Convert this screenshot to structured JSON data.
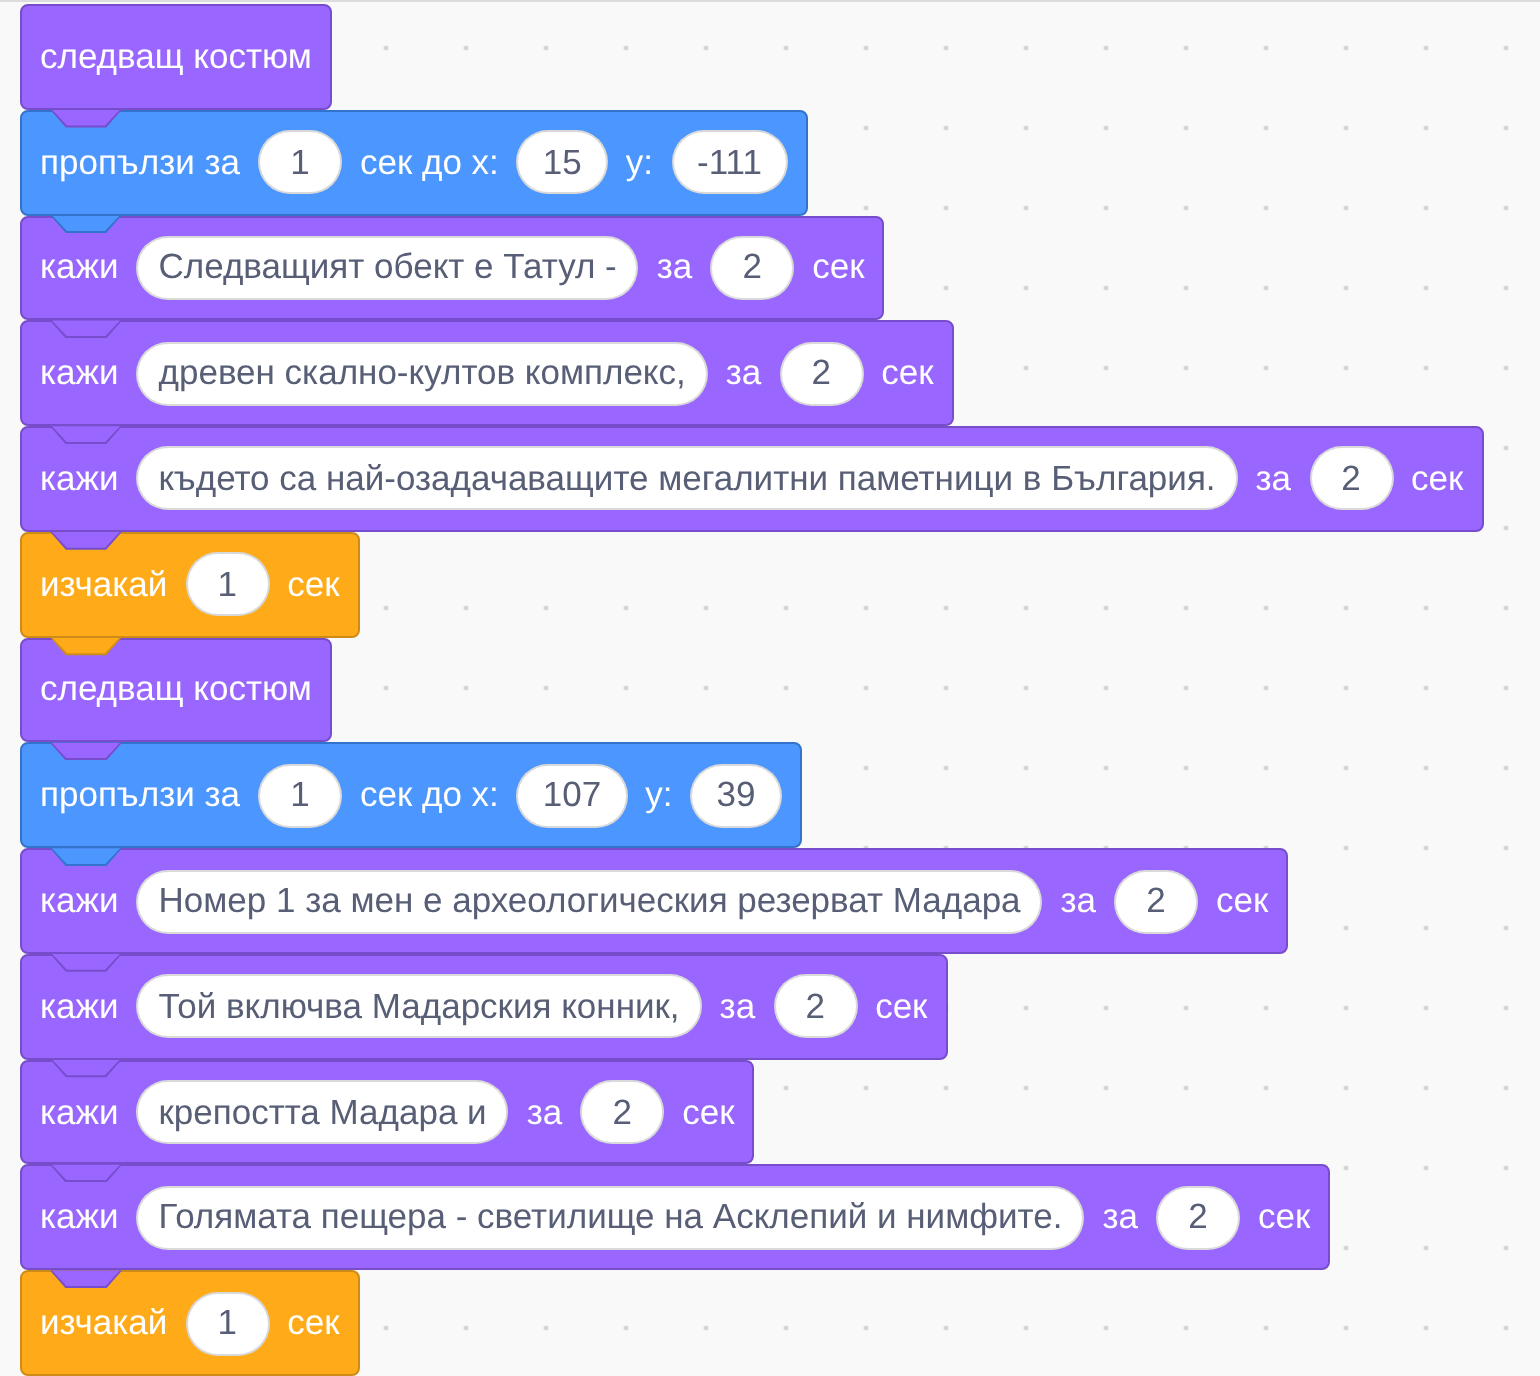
{
  "workspace": {
    "blocks": [
      {
        "kind": "looks",
        "parts": [
          {
            "kind": "label",
            "text": "следващ костюм"
          }
        ]
      },
      {
        "kind": "motion",
        "parts": [
          {
            "kind": "label",
            "text": "пропълзи за"
          },
          {
            "kind": "number",
            "text": "1"
          },
          {
            "kind": "label",
            "text": "сек до x:"
          },
          {
            "kind": "number",
            "text": "15"
          },
          {
            "kind": "label",
            "text": "y:"
          },
          {
            "kind": "number",
            "text": "-111"
          }
        ]
      },
      {
        "kind": "looks",
        "parts": [
          {
            "kind": "label",
            "text": "кажи"
          },
          {
            "kind": "text",
            "text": "Следващият обект е Татул -"
          },
          {
            "kind": "label",
            "text": "за"
          },
          {
            "kind": "number",
            "text": "2"
          },
          {
            "kind": "label",
            "text": "сек"
          }
        ]
      },
      {
        "kind": "looks",
        "parts": [
          {
            "kind": "label",
            "text": "кажи"
          },
          {
            "kind": "text",
            "text": "древен скално-култов комплекс,"
          },
          {
            "kind": "label",
            "text": "за"
          },
          {
            "kind": "number",
            "text": "2"
          },
          {
            "kind": "label",
            "text": "сек"
          }
        ]
      },
      {
        "kind": "looks",
        "parts": [
          {
            "kind": "label",
            "text": "кажи"
          },
          {
            "kind": "text",
            "text": "където са най-озадачаващите мегалитни паметници в България."
          },
          {
            "kind": "label",
            "text": "за"
          },
          {
            "kind": "number",
            "text": "2"
          },
          {
            "kind": "label",
            "text": "сек"
          }
        ]
      },
      {
        "kind": "control",
        "parts": [
          {
            "kind": "label",
            "text": "изчакай"
          },
          {
            "kind": "number",
            "text": "1"
          },
          {
            "kind": "label",
            "text": "сек"
          }
        ]
      },
      {
        "kind": "looks",
        "parts": [
          {
            "kind": "label",
            "text": "следващ костюм"
          }
        ]
      },
      {
        "kind": "motion",
        "parts": [
          {
            "kind": "label",
            "text": "пропълзи за"
          },
          {
            "kind": "number",
            "text": "1"
          },
          {
            "kind": "label",
            "text": "сек до x:"
          },
          {
            "kind": "number",
            "text": "107"
          },
          {
            "kind": "label",
            "text": "y:"
          },
          {
            "kind": "number",
            "text": "39"
          }
        ]
      },
      {
        "kind": "looks",
        "parts": [
          {
            "kind": "label",
            "text": "кажи"
          },
          {
            "kind": "text",
            "text": "Номер 1 за мен е археологическия резерват Мадара"
          },
          {
            "kind": "label",
            "text": "за"
          },
          {
            "kind": "number",
            "text": "2"
          },
          {
            "kind": "label",
            "text": "сек"
          }
        ]
      },
      {
        "kind": "looks",
        "parts": [
          {
            "kind": "label",
            "text": "кажи"
          },
          {
            "kind": "text",
            "text": "Той включва Мадарския конник,"
          },
          {
            "kind": "label",
            "text": "за"
          },
          {
            "kind": "number",
            "text": "2"
          },
          {
            "kind": "label",
            "text": "сек"
          }
        ]
      },
      {
        "kind": "looks",
        "parts": [
          {
            "kind": "label",
            "text": "кажи"
          },
          {
            "kind": "text",
            "text": "крепостта Мадара и"
          },
          {
            "kind": "label",
            "text": "за"
          },
          {
            "kind": "number",
            "text": "2"
          },
          {
            "kind": "label",
            "text": "сек"
          }
        ]
      },
      {
        "kind": "looks",
        "parts": [
          {
            "kind": "label",
            "text": "кажи"
          },
          {
            "kind": "text",
            "text": "Голямата пещера - светилище на Асклепий и нимфите."
          },
          {
            "kind": "label",
            "text": "за"
          },
          {
            "kind": "number",
            "text": "2"
          },
          {
            "kind": "label",
            "text": "сек"
          }
        ]
      },
      {
        "kind": "control",
        "parts": [
          {
            "kind": "label",
            "text": "изчакай"
          },
          {
            "kind": "number",
            "text": "1"
          },
          {
            "kind": "label",
            "text": "сек"
          }
        ]
      }
    ]
  }
}
